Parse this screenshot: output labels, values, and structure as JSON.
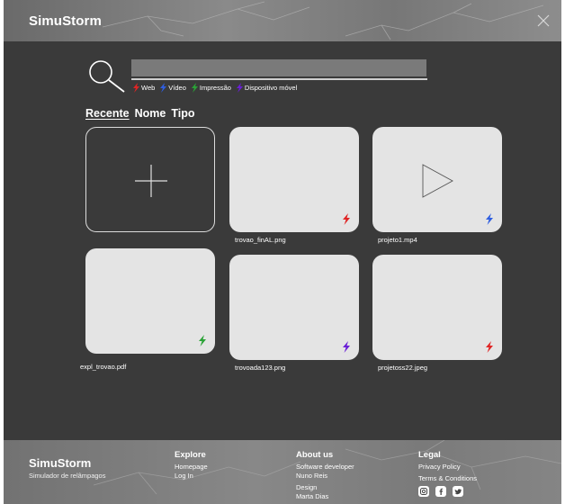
{
  "header": {
    "brand": "SimuStorm",
    "close_icon": "close-icon"
  },
  "search": {
    "value": "",
    "placeholder": "",
    "icon": "search-icon",
    "filters": [
      {
        "label": "Web",
        "color": "#e02424"
      },
      {
        "label": "Vídeo",
        "color": "#2f5ee0"
      },
      {
        "label": "Impressão",
        "color": "#2aa336"
      },
      {
        "label": "Dispositivo móvel",
        "color": "#6a1fd6"
      }
    ]
  },
  "sort": {
    "tabs": [
      "Recente",
      "Nome",
      "Tipo"
    ],
    "active": "Recente"
  },
  "files": [
    {
      "name": "trovao_finAL.png",
      "type": "Web",
      "color": "#e02424"
    },
    {
      "name": "projeto1.mp4",
      "type": "Vídeo",
      "color": "#2f5ee0",
      "icon": "play-icon"
    },
    {
      "name": "expl_trovao.pdf",
      "type": "Impressão",
      "color": "#2aa336"
    },
    {
      "name": "trovoada123.png",
      "type": "Dispositivo móvel",
      "color": "#6a1fd6"
    },
    {
      "name": "projetoss22.jpeg",
      "type": "Web",
      "color": "#e02424"
    }
  ],
  "footer": {
    "brand": "SimuStorm",
    "tagline": "Simulador de relâmpagos",
    "explore": {
      "heading": "Explore",
      "links": [
        "Homepage",
        "Log In"
      ]
    },
    "about": {
      "heading": "About us",
      "lines": [
        "Software developer",
        "Nuno Reis",
        "Design",
        "Marta Dias"
      ]
    },
    "legal": {
      "heading": "Legal",
      "links": [
        "Privacy Policy",
        "Terms & Conditions"
      ],
      "social_icons": [
        "instagram-icon",
        "facebook-icon",
        "twitter-icon"
      ]
    }
  }
}
